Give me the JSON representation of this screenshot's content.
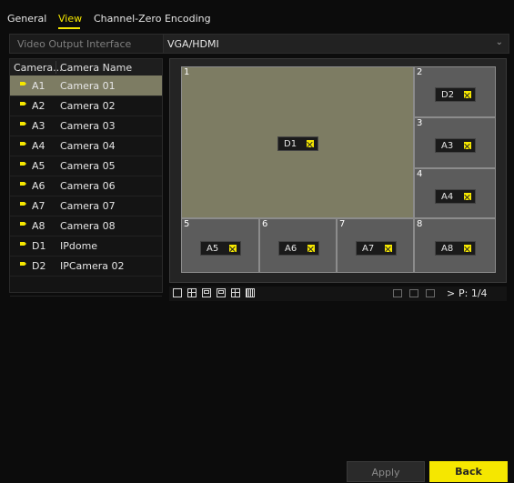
{
  "tabs": [
    {
      "label": "General"
    },
    {
      "label": "View"
    },
    {
      "label": "Channel-Zero Encoding"
    }
  ],
  "active_tab": "View",
  "colors": {
    "accent": "#f5e700",
    "selected": "#7d7c63",
    "background": "#0c0c0c"
  },
  "output": {
    "label": "Video Output Interface",
    "value": "VGA/HDMI"
  },
  "camera_list": {
    "headers": [
      "Camera...",
      "Camera Name"
    ],
    "rows": [
      {
        "no": "A1",
        "name": "Camera 01"
      },
      {
        "no": "A2",
        "name": "Camera 02"
      },
      {
        "no": "A3",
        "name": "Camera 03"
      },
      {
        "no": "A4",
        "name": "Camera 04"
      },
      {
        "no": "A5",
        "name": "Camera 05"
      },
      {
        "no": "A6",
        "name": "Camera 06"
      },
      {
        "no": "A7",
        "name": "Camera 07"
      },
      {
        "no": "A8",
        "name": "Camera 08"
      },
      {
        "no": "D1",
        "name": "IPdome"
      },
      {
        "no": "D2",
        "name": "IPCamera 02"
      }
    ],
    "selected": "A1"
  },
  "layout_windows": [
    {
      "num": "1",
      "cam": "D1"
    },
    {
      "num": "2",
      "cam": "D2"
    },
    {
      "num": "3",
      "cam": "A3"
    },
    {
      "num": "4",
      "cam": "A4"
    },
    {
      "num": "5",
      "cam": "A5"
    },
    {
      "num": "6",
      "cam": "A6"
    },
    {
      "num": "7",
      "cam": "A7"
    },
    {
      "num": "8",
      "cam": "A8"
    }
  ],
  "toolbar": {
    "page": "P: 1/4",
    "next": ">"
  },
  "buttons": {
    "apply": "Apply",
    "back": "Back"
  }
}
